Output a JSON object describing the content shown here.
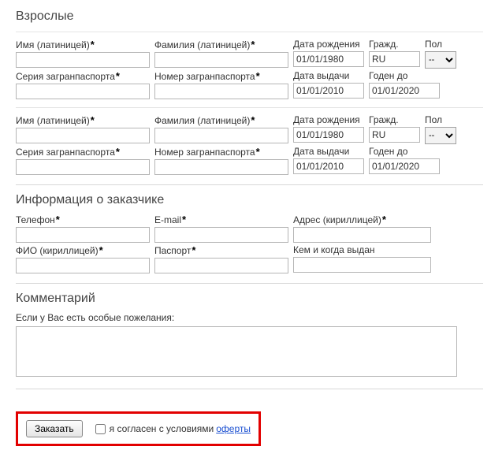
{
  "adults": {
    "heading": "Взрослые",
    "labels": {
      "firstname": "Имя (латиницей)",
      "lastname": "Фамилия (латиницей)",
      "dob": "Дата рождения",
      "citizenship": "Гражд.",
      "sex": "Пол",
      "pass_series": "Серия загранпаспорта",
      "pass_number": "Номер загранпаспорта",
      "issue_date": "Дата выдачи",
      "valid_until": "Годен до"
    },
    "persons": [
      {
        "firstname": "",
        "lastname": "",
        "dob": "01/01/1980",
        "citizenship": "RU",
        "sex": "--",
        "pass_series": "",
        "pass_number": "",
        "issue_date": "01/01/2010",
        "valid_until": "01/01/2020"
      },
      {
        "firstname": "",
        "lastname": "",
        "dob": "01/01/1980",
        "citizenship": "RU",
        "sex": "--",
        "pass_series": "",
        "pass_number": "",
        "issue_date": "01/01/2010",
        "valid_until": "01/01/2020"
      }
    ]
  },
  "customer": {
    "heading": "Информация о заказчике",
    "labels": {
      "phone": "Телефон",
      "email": "E-mail",
      "address": "Адрес (кириллицей)",
      "fio": "ФИО (кириллицей)",
      "passport": "Паспорт",
      "issued_by": "Кем и когда выдан"
    },
    "values": {
      "phone": "",
      "email": "",
      "address": "",
      "fio": "",
      "passport": "",
      "issued_by": ""
    }
  },
  "comment": {
    "heading": "Комментарий",
    "label": "Если у Вас есть особые пожелания:",
    "value": ""
  },
  "actions": {
    "order_button": "Заказать",
    "agree_text": "я согласен с условиями ",
    "offer_link": "оферты"
  },
  "asterisk": "*"
}
